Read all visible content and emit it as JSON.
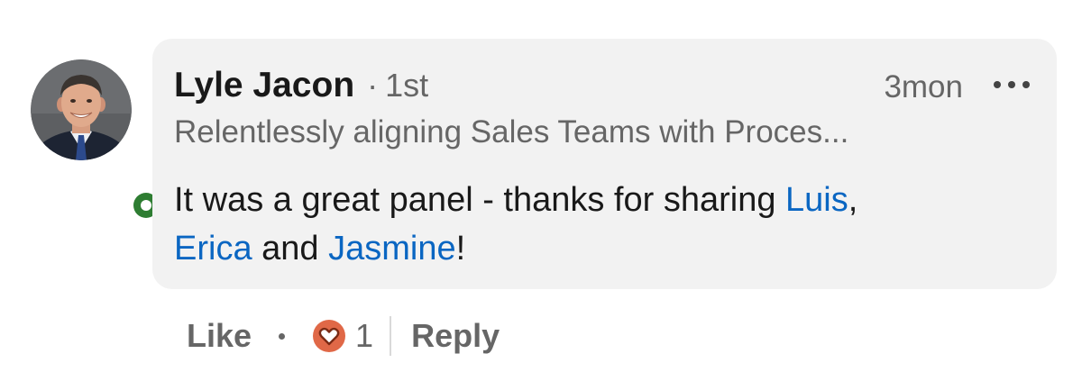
{
  "comment": {
    "author": {
      "name": "Lyle Jacon",
      "separator": "·",
      "degree": "1st",
      "headline": "Relentlessly aligning Sales Teams with Proces...",
      "online_status_color": "#2e7d32"
    },
    "timestamp": "3mon",
    "body": {
      "text_1": "It was a great panel - thanks for sharing ",
      "mention_1": "Luis",
      "text_2": ",",
      "mention_2": "Erica",
      "text_3": " and ",
      "mention_3": "Jasmine",
      "text_4": "!"
    },
    "colors": {
      "bubble_background": "#f2f2f2",
      "mention_link": "#0a66c2",
      "reaction_heart": "#e06847"
    }
  },
  "actions": {
    "like_label": "Like",
    "separator": "•",
    "reaction_icon": "heart-reaction-icon",
    "reaction_count": "1",
    "reply_label": "Reply"
  }
}
